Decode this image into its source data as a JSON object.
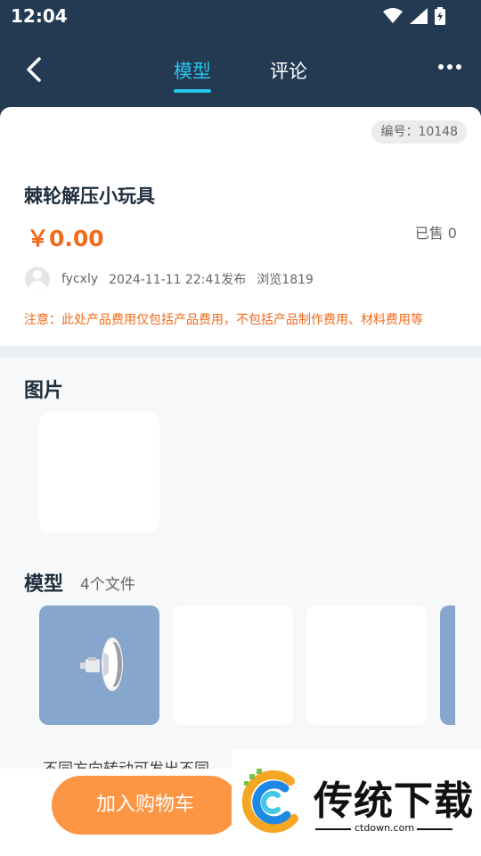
{
  "status": {
    "time": "12:04"
  },
  "nav": {
    "tabs": [
      {
        "label": "模型",
        "active": true
      },
      {
        "label": "评论",
        "active": false
      }
    ]
  },
  "product": {
    "serial": "编号：10148",
    "title": "棘轮解压小玩具",
    "price": "￥0.00",
    "sold": "已售 0",
    "author": "fycxly",
    "published": "2024-11-11 22:41发布",
    "views": "浏览1819",
    "notice": "注意：此处产品费用仅包括产品费用，不包括产品制作费用、材料费用等"
  },
  "pictures": {
    "title": "图片"
  },
  "models": {
    "title": "模型",
    "count": "4个文件"
  },
  "description": "不同方向转动可发出不同",
  "bottom": {
    "cart_label": "加入购物车"
  },
  "watermark": {
    "text": "传统下载",
    "url": "ctdown.com"
  },
  "colors": {
    "header": "#243a53",
    "accent": "#28c4ea",
    "price": "#f26a1b",
    "cart": "#fc9544",
    "model_bg": "#86a6cb"
  }
}
